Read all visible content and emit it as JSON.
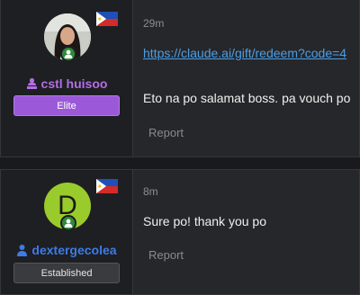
{
  "posts": [
    {
      "username": "cstl huisoo",
      "rank": "Elite",
      "time": "29m",
      "link": "https://claude.ai/gift/redeem?code=4",
      "message": "Eto na po salamat boss. pa vouch po",
      "report": "Report",
      "name_color": "#b46ee6",
      "flag": "philippines-flag-icon"
    },
    {
      "username": "dextergecolea",
      "avatar_letter": "D",
      "rank": "Established",
      "time": "8m",
      "message": "Sure po! thank you po",
      "report": "Report",
      "name_color": "#3d7be6",
      "flag": "philippines-flag-icon"
    }
  ]
}
